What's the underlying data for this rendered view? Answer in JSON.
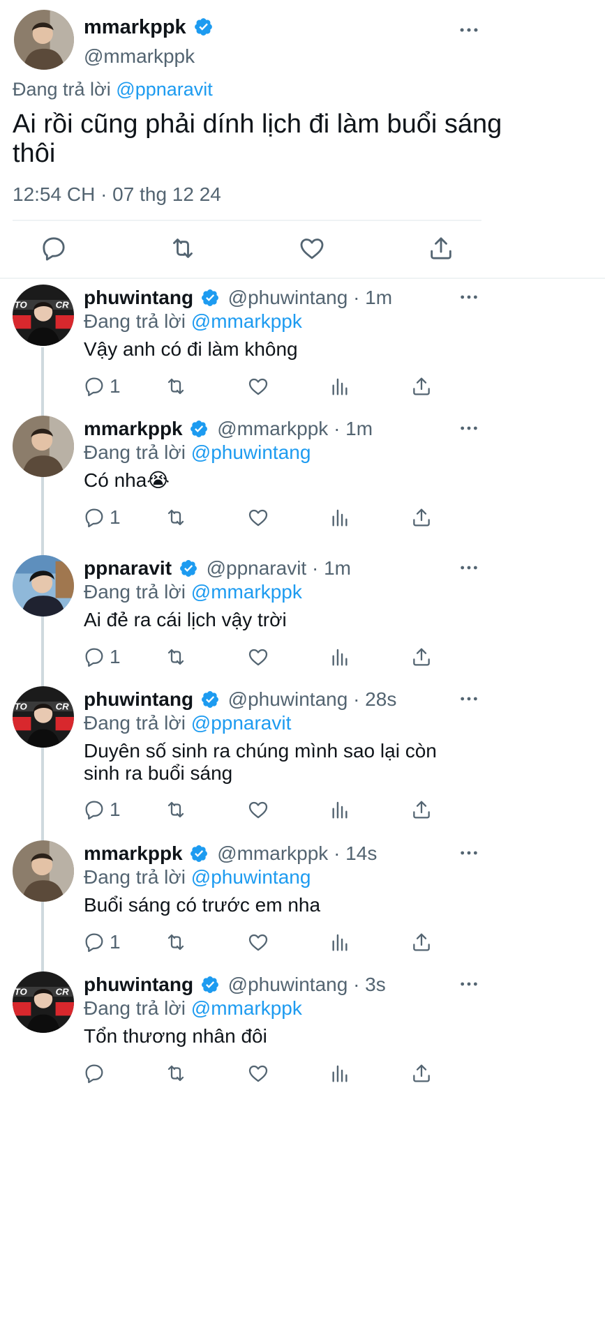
{
  "main_tweet": {
    "display_name": "mmarkppk",
    "handle": "@mmarkppk",
    "reply_prefix": "Đang trả lời",
    "reply_to": "@ppnaravit",
    "text_line1": "Ai rồi cũng phải dính lịch đi làm buổi sáng",
    "text_line2": "thôi",
    "timestamp": "12:54 CH · 07 thg 12 24"
  },
  "replies": [
    {
      "display_name": "phuwintang",
      "meta": "@phuwintang · 1m",
      "reply_prefix": "Đang trả lời",
      "reply_to": "@mmarkppk",
      "text": "Vậy anh có đi làm không",
      "reply_count": "1",
      "avatar": "red"
    },
    {
      "display_name": "mmarkppk",
      "meta": "@mmarkppk · 1m",
      "reply_prefix": "Đang trả lời",
      "reply_to": "@phuwintang",
      "text": "Có nha😭",
      "reply_count": "1",
      "avatar": "brown"
    },
    {
      "display_name": "ppnaravit",
      "meta": "@ppnaravit · 1m",
      "reply_prefix": "Đang trả lời",
      "reply_to": "@mmarkppk",
      "text": "Ai đẻ ra cái lịch vậy trời",
      "reply_count": "1",
      "avatar": "blue"
    },
    {
      "display_name": "phuwintang",
      "meta": "@phuwintang · 28s",
      "reply_prefix": "Đang trả lời",
      "reply_to": "@ppnaravit",
      "text": "Duyên số sinh ra chúng mình sao lại còn",
      "text2": "sinh ra buổi sáng",
      "reply_count": "1",
      "avatar": "red"
    },
    {
      "display_name": "mmarkppk",
      "meta": "@mmarkppk · 14s",
      "reply_prefix": "Đang trả lời",
      "reply_to": "@phuwintang",
      "text": "Buổi sáng có trước em nha",
      "reply_count": "1",
      "avatar": "brown"
    },
    {
      "display_name": "phuwintang",
      "meta": "@phuwintang · 3s",
      "reply_prefix": "Đang trả lời",
      "reply_to": "@mmarkppk",
      "text": "Tổn thương nhân đôi",
      "reply_count": "",
      "avatar": "red"
    }
  ],
  "colors": {
    "accent": "#1d9bf0",
    "text": "#0f1419",
    "secondary": "#536471"
  }
}
